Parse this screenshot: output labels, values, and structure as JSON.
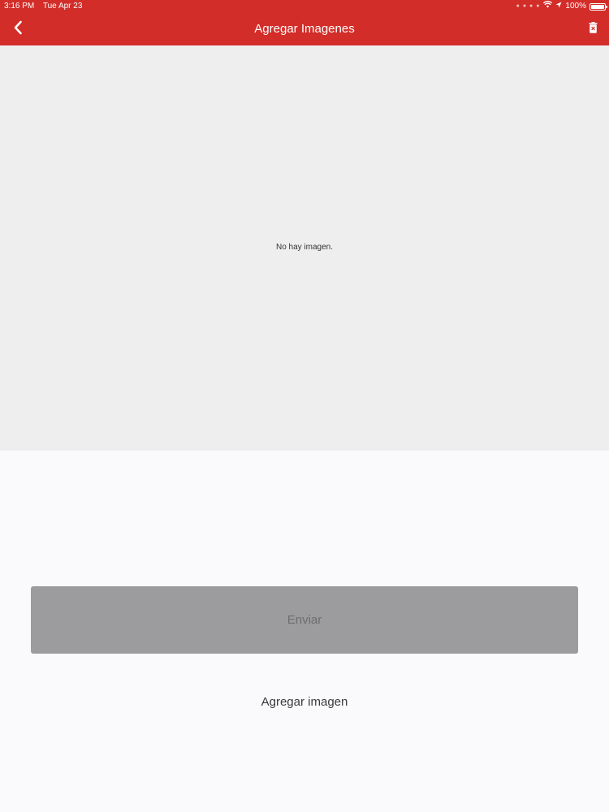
{
  "status_bar": {
    "time": "3:16 PM",
    "date": "Tue Apr 23",
    "battery": "100%"
  },
  "nav": {
    "title": "Agregar Imagenes",
    "back_icon": "chevron-left-icon",
    "delete_icon": "trash-icon"
  },
  "image_area": {
    "empty_text": "No hay imagen."
  },
  "actions": {
    "send_label": "Enviar",
    "add_image_label": "Agregar imagen"
  },
  "colors": {
    "header": "#d22d29",
    "image_area_bg": "#efeeef",
    "page_bg": "#faf9fb",
    "send_button_bg": "#9c9b9e"
  }
}
